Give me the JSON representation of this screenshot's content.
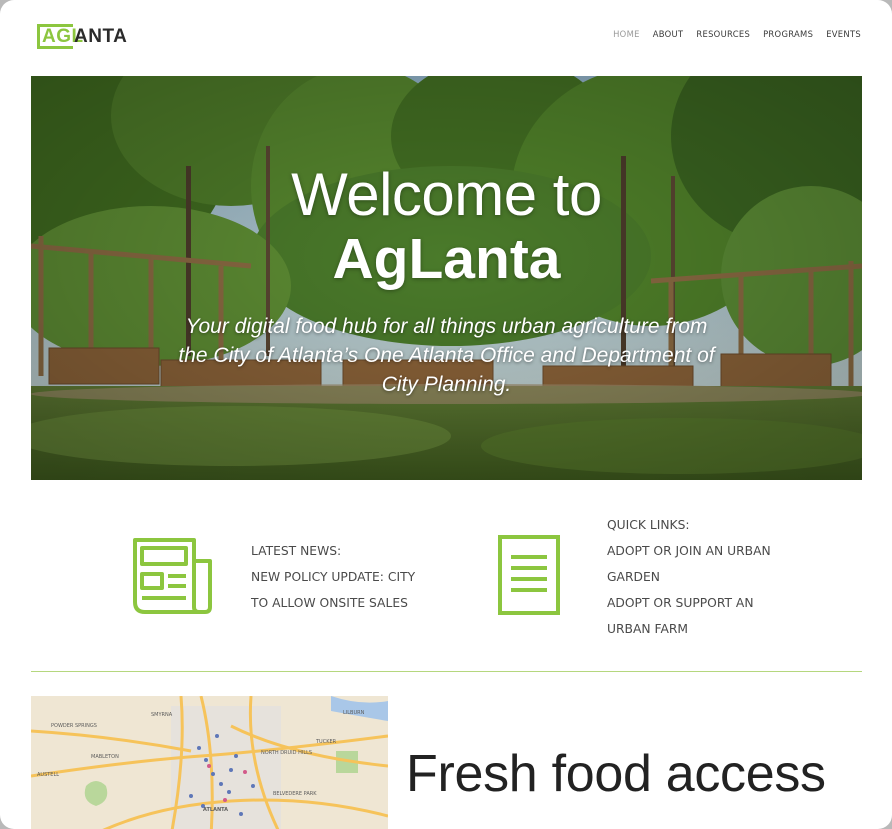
{
  "brand": {
    "logo_green": "AGL",
    "logo_dark": "ANTA"
  },
  "nav": {
    "items": [
      "HOME",
      "ABOUT",
      "RESOURCES",
      "PROGRAMS",
      "EVENTS"
    ],
    "active": "HOME"
  },
  "hero": {
    "title_line1": "Welcome to",
    "title_line2": "AgLanta",
    "subtitle_line1": "Your digital food hub for all things urban agriculture from",
    "subtitle_line2": "the City of Atlanta’s One Atlanta Office and Department of",
    "subtitle_line3": "City Planning."
  },
  "news": {
    "heading": "LATEST NEWS:",
    "link_line1": "NEW POLICY UPDATE:  CITY",
    "link_line2": "TO ALLOW ONSITE SALES"
  },
  "quick_links": {
    "heading": "QUICK LINKS:",
    "link1_line1": "ADOPT OR JOIN AN URBAN",
    "link1_line2": "GARDEN",
    "link2_line1": "ADOPT OR SUPPORT  AN",
    "link2_line2": "URBAN FARM"
  },
  "map": {
    "labels": [
      "POWDER SPRINGS",
      "MABLETON",
      "AUSTELL",
      "LILBURN",
      "TUCKER",
      "NORTH DRUID HILLS",
      "BELVEDERE PARK",
      "ATLANTA",
      "SMYRNA"
    ]
  },
  "feature": {
    "heading": "Fresh food access"
  },
  "colors": {
    "brand_green": "#8cc63f",
    "text_dark": "#2b2b2b",
    "nav_active": "#9a9a9a"
  }
}
